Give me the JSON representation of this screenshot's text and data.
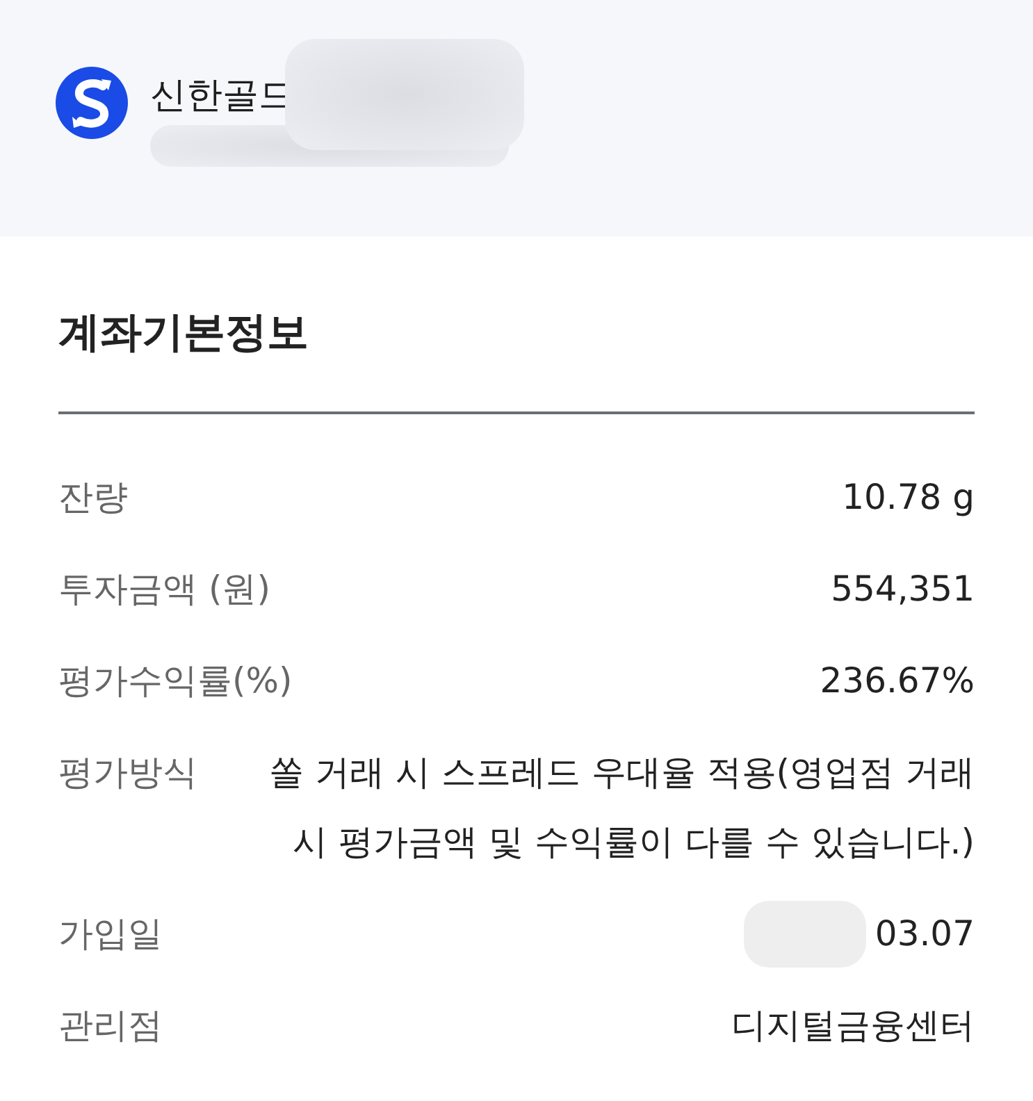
{
  "header": {
    "product_name": "신한골드",
    "account_redacted": true
  },
  "section": {
    "title": "계좌기본정보"
  },
  "rows": [
    {
      "label": "잔량",
      "value": "10.78 g",
      "redacted": false
    },
    {
      "label": "투자금액 (원)",
      "value": "554,351",
      "redacted": false
    },
    {
      "label": "평가수익률(%)",
      "value": "236.67%",
      "redacted": false
    },
    {
      "label": "평가방식",
      "value": "쏠 거래 시 스프레드 우대율 적용(영업점 거래 시 평가금액 및 수익률이 다를 수 있습니다.)",
      "redacted": false
    },
    {
      "label": "가입일",
      "value": "03.07",
      "redacted": true
    },
    {
      "label": "관리점",
      "value": "디지털금융센터",
      "redacted": false
    }
  ]
}
